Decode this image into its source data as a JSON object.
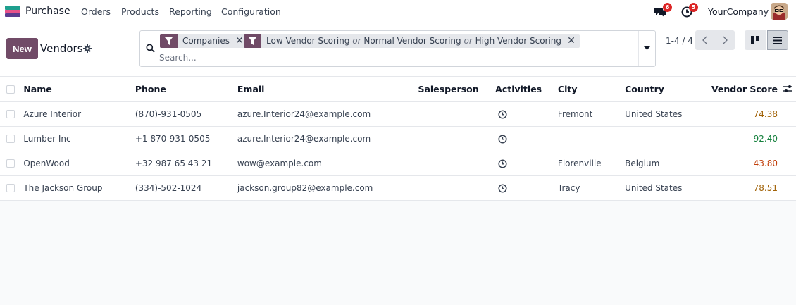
{
  "navbar": {
    "app_name": "Purchase",
    "menu": [
      "Orders",
      "Products",
      "Reporting",
      "Configuration"
    ],
    "messages_count": "6",
    "activities_count": "5",
    "company": "YourCompany"
  },
  "control": {
    "new_label": "New",
    "breadcrumb": "Vendors",
    "facets": {
      "first": "Companies",
      "second_parts": [
        "Low Vendor Scoring",
        "or",
        "Normal Vendor Scoring",
        "or",
        "High Vendor Scoring"
      ]
    },
    "search_placeholder": "Search...",
    "pager": "1-4 / 4"
  },
  "table": {
    "columns": [
      "Name",
      "Phone",
      "Email",
      "Salesperson",
      "Activities",
      "City",
      "Country",
      "Vendor Score"
    ],
    "rows": [
      {
        "name": "Azure Interior",
        "phone": "(870)-931-0505",
        "email": "azure.Interior24@example.com",
        "salesperson": "",
        "city": "Fremont",
        "country": "United States",
        "score": "74.38",
        "score_color": "#a16207"
      },
      {
        "name": "Lumber Inc",
        "phone": "+1 870-931-0505",
        "email": "azure.Interior24@example.com",
        "salesperson": "",
        "city": "",
        "country": "",
        "score": "92.40",
        "score_color": "#15803d"
      },
      {
        "name": "OpenWood",
        "phone": "+32 987 65 43 21",
        "email": "wow@example.com",
        "salesperson": "",
        "city": "Florenville",
        "country": "Belgium",
        "score": "43.80",
        "score_color": "#c2410c"
      },
      {
        "name": "The Jackson Group",
        "phone": "(334)-502-1024",
        "email": "jackson.group82@example.com",
        "salesperson": "",
        "city": "Tracy",
        "country": "United States",
        "score": "78.51",
        "score_color": "#a16207"
      }
    ]
  },
  "colors": {
    "brand": "#714b67",
    "badge": "#dc2626"
  },
  "icons": [
    "app-icon",
    "chat-icon",
    "clock-icon",
    "avatar",
    "gear-icon",
    "search-icon",
    "filter-icon",
    "remove-icon",
    "caret-down-icon",
    "chevron-left-icon",
    "chevron-right-icon",
    "kanban-view-icon",
    "list-view-icon",
    "optional-columns-icon"
  ]
}
